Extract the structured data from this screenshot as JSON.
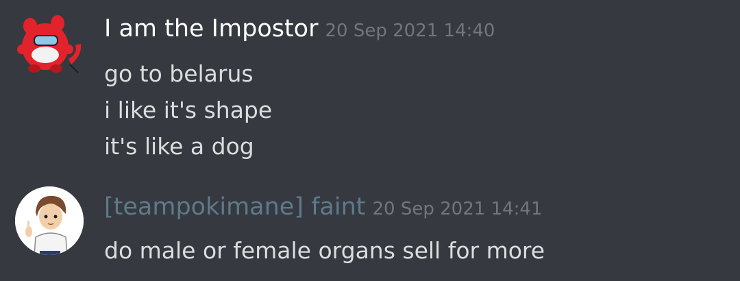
{
  "messages": [
    {
      "username": "I am the Impostor",
      "timestamp": "20 Sep 2021 14:40",
      "lines": [
        "go to belarus",
        "i like it's shape",
        "it's like a dog"
      ],
      "username_color": "#ffffff",
      "avatar_icon": "red-crewmate-monster-icon"
    },
    {
      "username": "[teampokimane] faint",
      "timestamp": "20 Sep 2021 14:41",
      "lines": [
        "do male or female organs sell for more"
      ],
      "username_color": "#5e7a8c",
      "avatar_icon": "trainer-avatar-icon"
    }
  ],
  "theme": {
    "background": "#36393f",
    "text": "#dcddde",
    "muted": "#72767d"
  }
}
